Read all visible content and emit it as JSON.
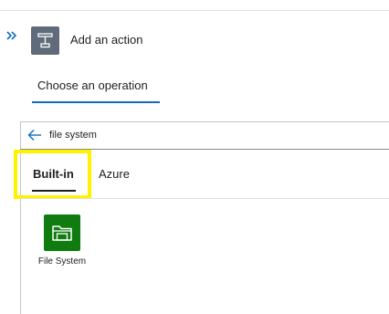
{
  "header": {
    "title": "Add an action",
    "icons": {
      "expand": "double-chevron-right-icon",
      "action": "action-trigger-icon"
    }
  },
  "operation_tab": {
    "label": "Choose an operation"
  },
  "search": {
    "value": "file system",
    "back_icon": "back-arrow-icon"
  },
  "tabs": [
    {
      "label": "Built-in",
      "selected": true,
      "highlighted": true
    },
    {
      "label": "Azure",
      "selected": false
    }
  ],
  "connectors": [
    {
      "label": "File System",
      "icon": "folder-icon",
      "color": "#107c10"
    }
  ],
  "colors": {
    "accent": "#0f6cbd",
    "highlight": "#fff200",
    "action_icon_bg": "#5f6b7a",
    "connector_green": "#107c10"
  }
}
